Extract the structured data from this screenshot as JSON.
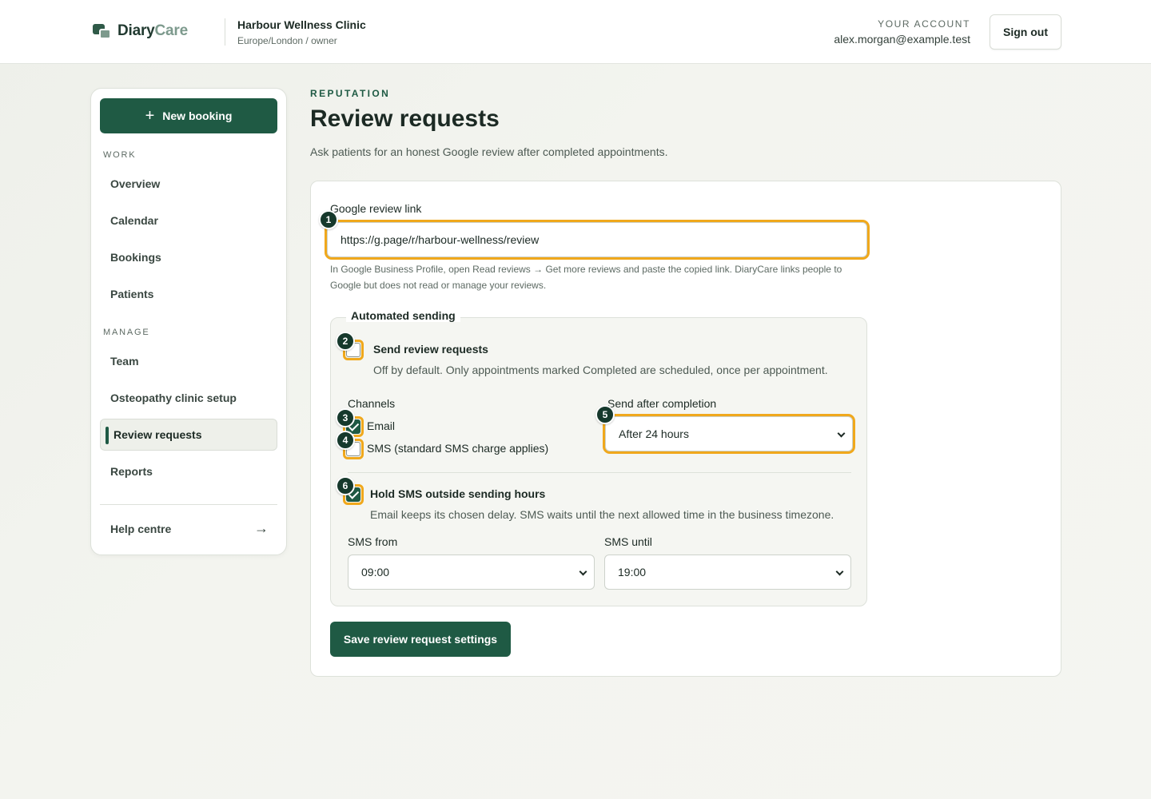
{
  "header": {
    "brand_part1": "Diary",
    "brand_part2": "Care",
    "clinic_name": "Harbour Wellness Clinic",
    "clinic_meta": "Europe/London / owner",
    "account_label": "YOUR ACCOUNT",
    "account_email": "alex.morgan@example.test",
    "signout_label": "Sign out"
  },
  "sidebar": {
    "new_booking_label": "New booking",
    "work_label": "WORK",
    "manage_label": "MANAGE",
    "work_items": [
      "Overview",
      "Calendar",
      "Bookings",
      "Patients"
    ],
    "manage_items": [
      "Team",
      "Osteopathy clinic setup",
      "Review requests",
      "Reports"
    ],
    "active_item": "Review requests",
    "help_label": "Help centre"
  },
  "page": {
    "eyebrow": "REPUTATION",
    "title": "Review requests",
    "subtitle": "Ask patients for an honest Google review after completed appointments."
  },
  "form": {
    "link_label": "Google review link",
    "link_value": "https://g.page/r/harbour-wellness/review",
    "link_help": "In Google Business Profile, open Read reviews → Get more reviews and paste the copied link. DiaryCare links people to Google but does not read or manage your reviews.",
    "automated_legend": "Automated sending",
    "send_requests_title": "Send review requests",
    "send_requests_desc": "Off by default. Only appointments marked Completed are scheduled, once per appointment.",
    "send_requests_checked": false,
    "channels_label": "Channels",
    "email_label": "Email",
    "email_checked": true,
    "sms_label": "SMS (standard SMS charge applies)",
    "sms_checked": false,
    "delay_label": "Send after completion",
    "delay_value": "After 24 hours",
    "hold_sms_title": "Hold SMS outside sending hours",
    "hold_sms_desc": "Email keeps its chosen delay. SMS waits until the next allowed time in the business timezone.",
    "hold_sms_checked": true,
    "sms_from_label": "SMS from",
    "sms_from_value": "09:00",
    "sms_until_label": "SMS until",
    "sms_until_value": "19:00",
    "save_label": "Save review request settings"
  },
  "badges": [
    "1",
    "2",
    "3",
    "4",
    "5",
    "6"
  ],
  "colors": {
    "brand_green": "#1f5a44",
    "highlight": "#f0a81c",
    "badge": "#16392c"
  }
}
